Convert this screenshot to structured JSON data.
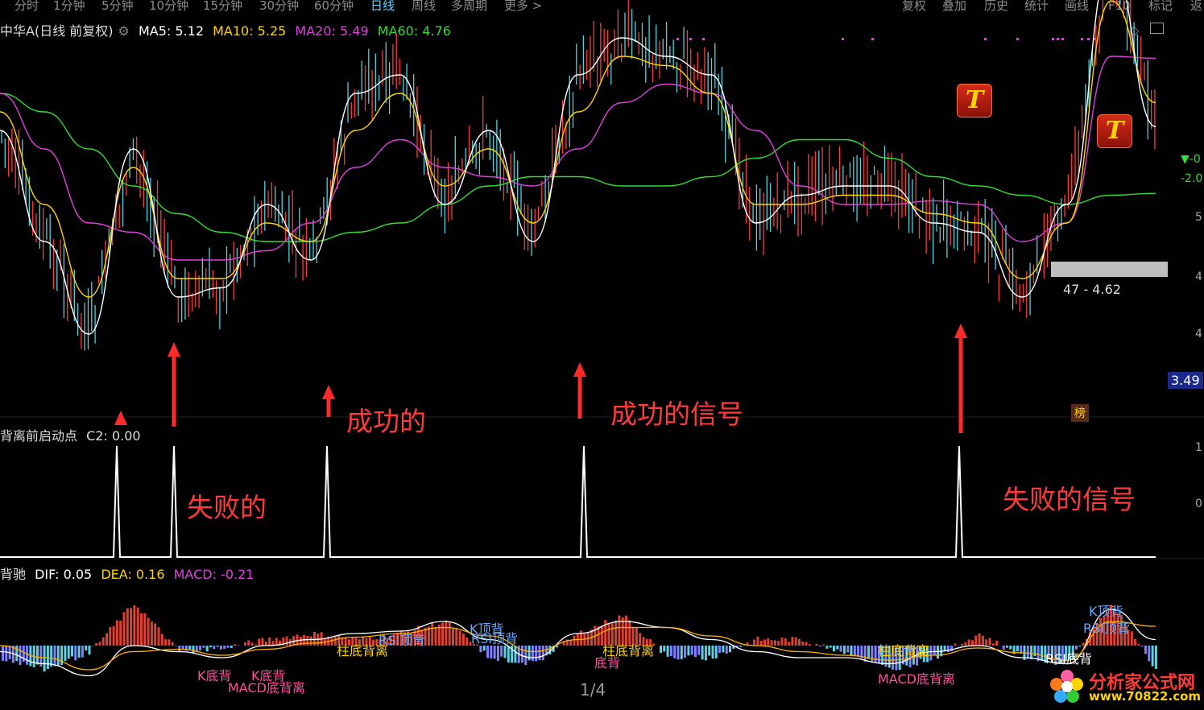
{
  "tabs": [
    "分时",
    "1分钟",
    "5分钟",
    "10分钟",
    "15分钟",
    "30分钟",
    "60分钟",
    "日线",
    "周线",
    "多周期",
    "更多 >"
  ],
  "active_tab": "日线",
  "right_menu": [
    "复权",
    "叠加",
    "历史",
    "统计",
    "画线",
    "F10",
    "标记",
    "返"
  ],
  "main_header": {
    "stock": "中华A(日线 前复权)",
    "ma5_label": "MA5: 5.12",
    "ma10_label": "MA10: 5.25",
    "ma20_label": "MA20: 5.49",
    "ma60_label": "MA60: 4.76",
    "colors": {
      "ma5": "#ffffff",
      "ma10": "#ffd400",
      "ma20": "#e040e0",
      "ma60": "#33dd33"
    }
  },
  "signal_header": {
    "name": "背离前启动点",
    "value": "C2: 0.00"
  },
  "macd_header": {
    "name": "背驰",
    "dif": "DIF: 0.05",
    "dea": "DEA: 0.16",
    "macd": "MACD: -0.21"
  },
  "annotations": {
    "failed": "失败的",
    "success": "成功的",
    "success_signal": "成功的信号",
    "failed_signal": "失败的信号"
  },
  "right_labels": {
    "range": "47 - 4.62",
    "price_box": "3.49",
    "list_badge": "榜",
    "pct1": "▼-0",
    "pct2": "-2.0"
  },
  "axis_digits": [
    "5",
    "4",
    "4",
    "1",
    "0"
  ],
  "macd_markers": [
    {
      "text": "K底背",
      "color": "#ff4da0"
    },
    {
      "text": "MACD底背离",
      "color": "#ff4da0"
    },
    {
      "text": "K底背",
      "color": "#ff4da0"
    },
    {
      "text": "柱底背离",
      "color": "#ffd400"
    },
    {
      "text": "RSI顶背",
      "color": "#66aaff"
    },
    {
      "text": "K顶背",
      "color": "#66aaff"
    },
    {
      "text": "RSI顶背",
      "color": "#66aaff"
    },
    {
      "text": "柱底背离",
      "color": "#ffd400"
    },
    {
      "text": "底背",
      "color": "#ff4da0"
    },
    {
      "text": "柱底背离",
      "color": "#ffd400"
    },
    {
      "text": "MACD底背离",
      "color": "#ff4da0"
    },
    {
      "text": "RSI底背",
      "color": "#ffffff"
    },
    {
      "text": "K顶背",
      "color": "#66aaff"
    },
    {
      "text": "RSI顶背",
      "color": "#66aaff"
    }
  ],
  "page_indicator": "1/4",
  "logo": {
    "name": "分析家公式网",
    "url": "www.70822.com"
  },
  "chart_data": [
    {
      "type": "line",
      "title": "中华A(日线 前复权)",
      "note": "Daily candlestick chart with moving averages; values estimated from price scale",
      "series": [
        {
          "name": "MA60",
          "values": [
            5.3,
            5.2,
            5.0,
            4.8,
            4.65,
            4.55,
            4.5,
            4.5,
            4.55,
            4.6,
            4.7,
            4.8,
            4.85,
            4.85,
            4.8,
            4.8,
            4.85,
            4.95,
            5.05,
            5.05,
            4.95,
            4.85,
            4.8,
            4.75,
            4.7,
            4.75,
            4.76
          ]
        },
        {
          "name": "MA20",
          "values": [
            5.3,
            5.0,
            4.6,
            4.55,
            4.4,
            4.4,
            4.45,
            4.6,
            4.9,
            5.05,
            4.9,
            4.85,
            4.8,
            5.0,
            5.25,
            5.35,
            5.3,
            5.1,
            4.8,
            4.7,
            4.7,
            4.72,
            4.7,
            4.5,
            4.6,
            5.5,
            5.49
          ]
        },
        {
          "name": "MA10",
          "values": [
            5.2,
            4.7,
            4.2,
            4.9,
            4.3,
            4.3,
            4.6,
            4.5,
            5.1,
            5.3,
            4.8,
            5.0,
            4.6,
            5.2,
            5.5,
            5.45,
            5.3,
            4.7,
            4.7,
            4.75,
            4.75,
            4.65,
            4.6,
            4.3,
            4.6,
            5.8,
            5.25
          ]
        },
        {
          "name": "MA5",
          "values": [
            5.1,
            4.5,
            4.0,
            5.0,
            4.2,
            4.25,
            4.7,
            4.4,
            5.3,
            5.4,
            4.7,
            5.1,
            4.5,
            5.4,
            5.6,
            5.5,
            5.4,
            4.6,
            4.75,
            4.8,
            4.8,
            4.6,
            4.55,
            4.2,
            4.7,
            6.0,
            5.12
          ]
        }
      ]
    },
    {
      "type": "line",
      "title": "背离前启动点",
      "series": [
        {
          "name": "C2",
          "values": [
            0,
            1,
            0,
            1,
            0,
            0,
            1,
            0,
            0,
            0,
            0,
            0,
            1,
            0,
            0,
            0,
            0,
            0,
            0,
            0,
            0,
            1,
            0,
            0,
            0,
            0,
            0
          ]
        }
      ]
    },
    {
      "type": "bar",
      "title": "背驰",
      "series": [
        {
          "name": "MACD",
          "values": [
            -0.1,
            -0.2,
            -0.05,
            0.35,
            -0.05,
            -0.02,
            0.05,
            0.1,
            0.05,
            0.1,
            0.2,
            -0.1,
            -0.15,
            0.1,
            0.25,
            -0.1,
            -0.1,
            0.05,
            0.05,
            -0.05,
            -0.2,
            -0.1,
            0.1,
            -0.1,
            -0.15,
            0.35,
            -0.21
          ]
        },
        {
          "name": "DIF",
          "values": [
            -0.05,
            -0.15,
            -0.25,
            0.0,
            -0.05,
            -0.1,
            0.0,
            0.05,
            0.1,
            0.12,
            0.2,
            0.05,
            -0.1,
            0.1,
            0.2,
            0.15,
            0.05,
            -0.05,
            -0.1,
            -0.1,
            -0.15,
            -0.05,
            0.0,
            -0.1,
            -0.15,
            0.3,
            0.05
          ]
        },
        {
          "name": "DEA",
          "values": [
            0.0,
            -0.1,
            -0.2,
            -0.05,
            -0.03,
            -0.08,
            -0.03,
            0.02,
            0.07,
            0.1,
            0.15,
            0.08,
            -0.05,
            0.05,
            0.15,
            0.15,
            0.08,
            0.0,
            -0.05,
            -0.08,
            -0.12,
            -0.08,
            -0.02,
            -0.06,
            -0.12,
            0.2,
            0.16
          ]
        }
      ]
    }
  ]
}
